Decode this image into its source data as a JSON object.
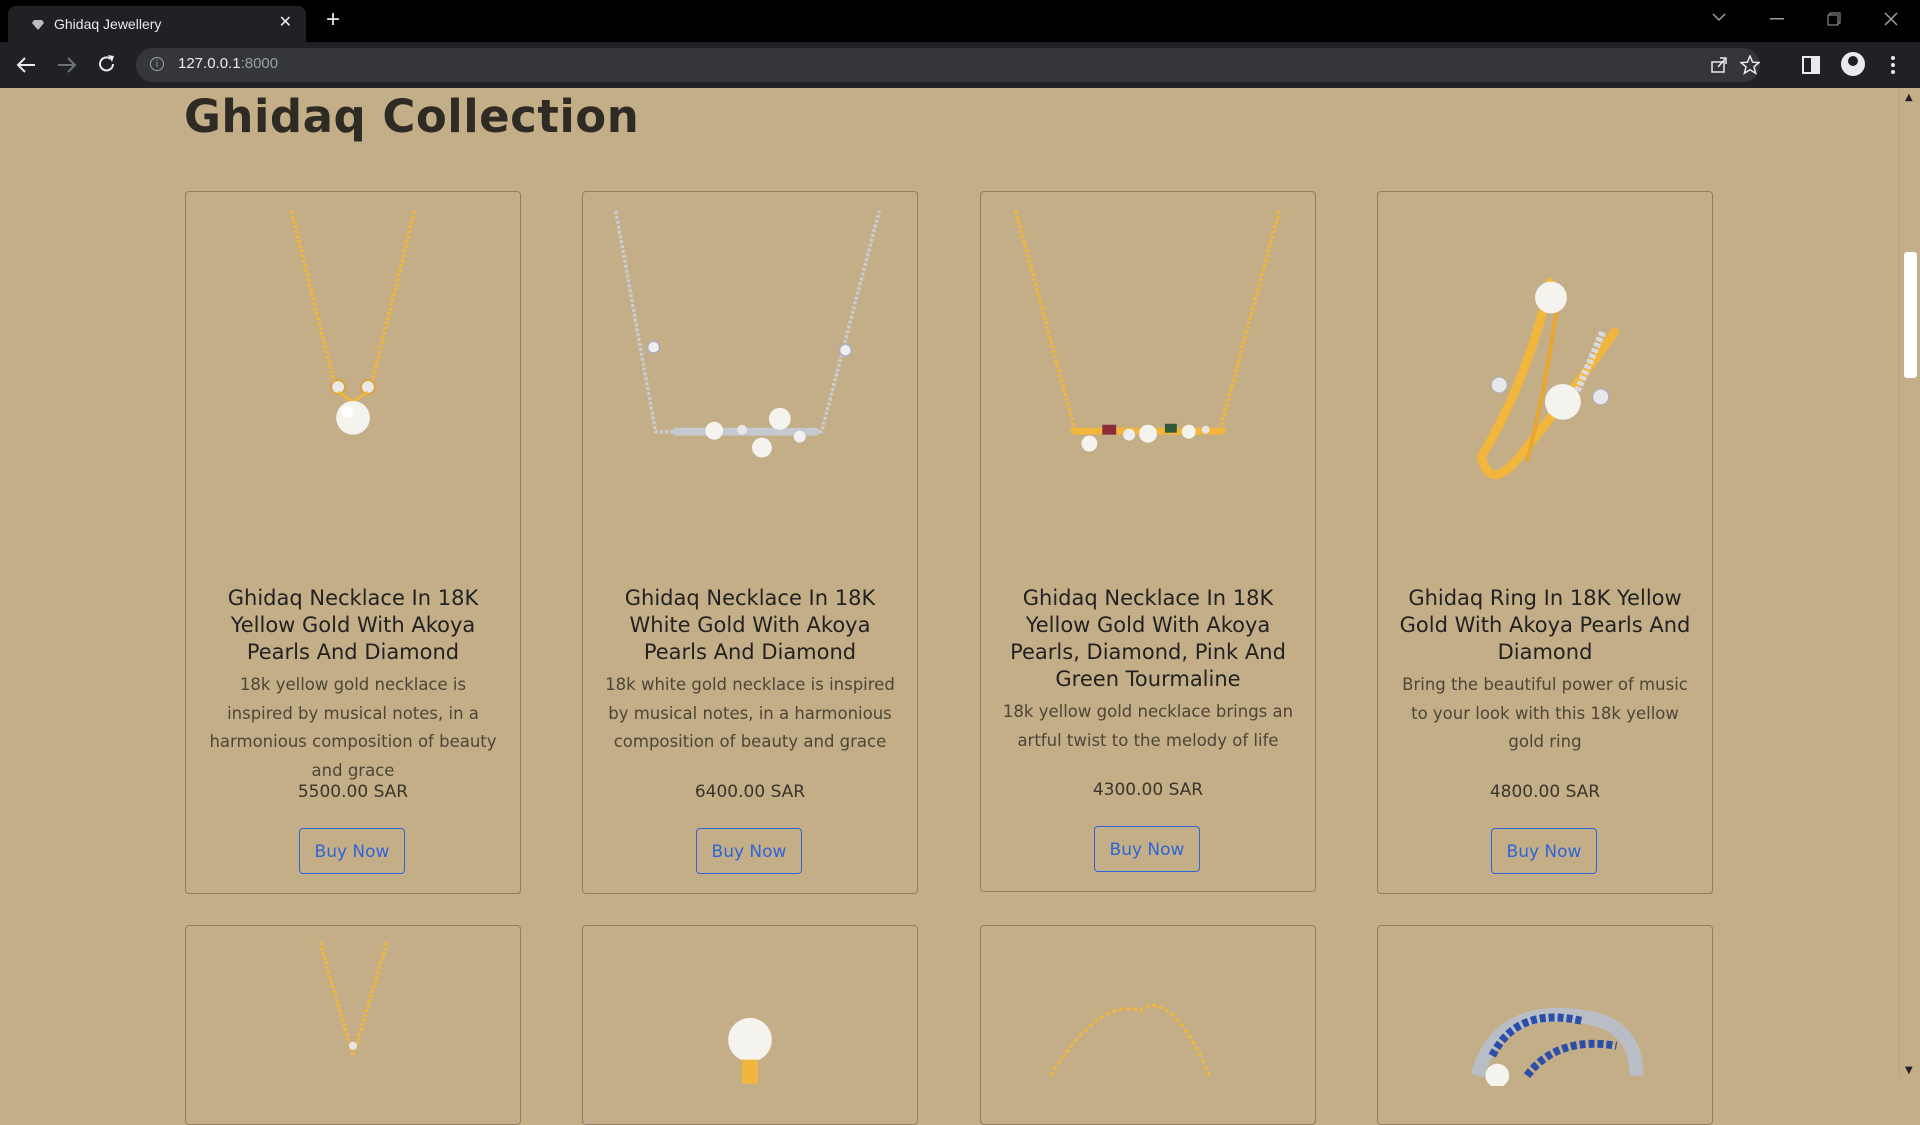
{
  "browser": {
    "tab_title": "Ghidaq Jewellery",
    "close_glyph": "✕",
    "newtab_glyph": "+",
    "url_host": "127.0.0.1",
    "url_port": ":8000",
    "info_glyph": "i"
  },
  "page": {
    "title": "Ghidaq Collection"
  },
  "products": [
    {
      "name": "Ghidaq Necklace In 18K Yellow Gold With Akoya Pearls And Diamond",
      "description": "18k yellow gold necklace is inspired by musical notes, in a harmonious composition of beauty and grace",
      "price": "5500.00 SAR",
      "button": "Buy Now",
      "image_icon": "yellow-gold-pearl-necklace-image"
    },
    {
      "name": "Ghidaq Necklace In 18K White Gold With Akoya Pearls And Diamond",
      "description": "18k white gold necklace is inspired by musical notes, in a harmonious composition of beauty and grace",
      "price": "6400.00 SAR",
      "button": "Buy Now",
      "image_icon": "white-gold-pearl-necklace-image"
    },
    {
      "name": "Ghidaq Necklace In 18K Yellow Gold With Akoya Pearls, Diamond, Pink And Green Tourmaline",
      "description": "18k yellow gold necklace brings an artful twist to the melody of life",
      "price": "4300.00 SAR",
      "button": "Buy Now",
      "image_icon": "tourmaline-bar-necklace-image"
    },
    {
      "name": "Ghidaq Ring In 18K Yellow Gold With Akoya Pearls And Diamond",
      "description": "Bring the beautiful power of music to your look with this 18k yellow gold ring",
      "price": "4800.00 SAR",
      "button": "Buy Now",
      "image_icon": "pearl-ring-image"
    }
  ],
  "colors": {
    "page_background": "#c4ae88",
    "button_accent": "#2f64d6",
    "gold": "#f2b63c",
    "white_gold": "#c9ccd2"
  }
}
